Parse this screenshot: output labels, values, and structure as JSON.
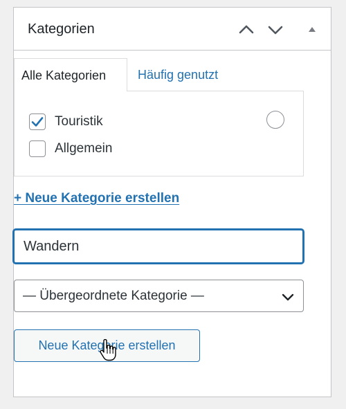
{
  "panel": {
    "title": "Kategorien",
    "header_icons": [
      "chevron-up-icon",
      "chevron-down-icon",
      "triangle-up-icon"
    ]
  },
  "tabs": [
    {
      "label": "Alle Kategorien",
      "active": true
    },
    {
      "label": "Häufig genutzt",
      "active": false
    }
  ],
  "categories": [
    {
      "label": "Touristik",
      "checked": true
    },
    {
      "label": "Allgemein",
      "checked": false
    }
  ],
  "add_category_link": "+ Neue Kategorie erstellen",
  "new_category_input": {
    "value": "Wandern"
  },
  "parent_select": {
    "selected": "— Übergeordnete Kategorie —"
  },
  "submit_button": {
    "label": "Neue Kategorie erstellen"
  },
  "colors": {
    "accent": "#2271b1",
    "border": "#c3c4c7",
    "text": "#1d2327",
    "background": "#f0f0f1"
  }
}
